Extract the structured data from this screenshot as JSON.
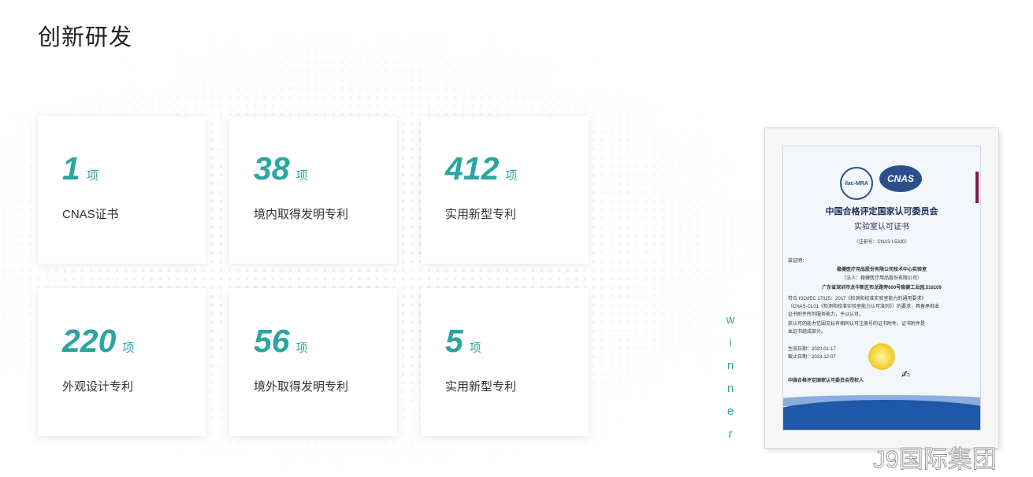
{
  "section": {
    "title": "创新研发"
  },
  "stats": [
    {
      "value": "1",
      "unit": "项",
      "label": "CNAS证书"
    },
    {
      "value": "38",
      "unit": "项",
      "label": "境内取得发明专利"
    },
    {
      "value": "412",
      "unit": "项",
      "label": "实用新型专利"
    },
    {
      "value": "220",
      "unit": "项",
      "label": "外观设计专利"
    },
    {
      "value": "56",
      "unit": "项",
      "label": "境外取得发明专利"
    },
    {
      "value": "5",
      "unit": "项",
      "label": "实用新型专利"
    }
  ],
  "side_text": [
    "w",
    "i",
    "n",
    "n",
    "e",
    "r"
  ],
  "certificate": {
    "logo_ilac": "ilac-MRA",
    "logo_cnas": "CNAS",
    "issuer": "中国合格评定国家认可委员会",
    "title": "实验室认可证书",
    "reg_no": "（注册号：CNAS L5320）",
    "lines": [
      "兹证明：",
      "稳健医疗用品股份有限公司技术中心实验室",
      "（法人：稳健医疗用品股份有限公司）",
      "广东省深圳市龙华新区布龙路旁660号稳健工业园,518109",
      "符合 ISO/IEC 17025：2017《检测和校准实验室能力的通用要求》",
      "（CNAS-CL01《检测和校准实验室能力认可准则》）的要求，具备承担本",
      "证书附件所列服务能力，予以认可。",
      "获认可的能力范围见标有相同认可注册号的证书附件，证书附件是",
      "本证书组成部分。",
      "生效日期：2020-01-17",
      "截止日期：2023-12-07",
      "中国合格评定国家认可委员会授权人"
    ]
  },
  "watermark": "J9国际集团",
  "colors": {
    "accent": "#2aa6a1",
    "text": "#333333",
    "title": "#222222"
  }
}
